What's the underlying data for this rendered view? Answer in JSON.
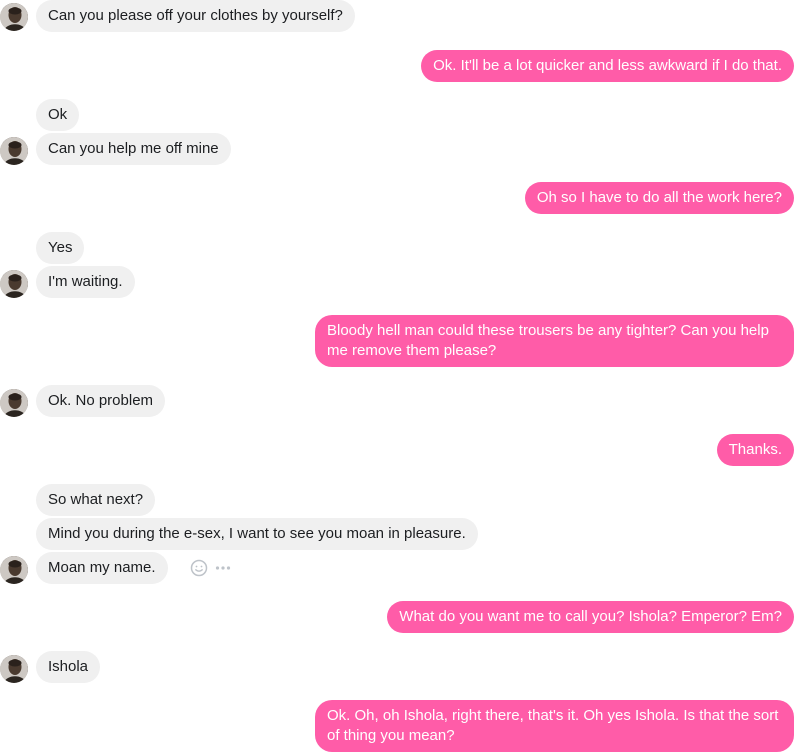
{
  "messages": [
    {
      "side": "in",
      "text": "Can you please off your clothes by yourself?"
    },
    {
      "side": "out",
      "text": "Ok. It'll be a lot quicker and less awkward if I do that."
    },
    {
      "side": "in",
      "text": "Ok"
    },
    {
      "side": "in",
      "text": "Can you help me off mine"
    },
    {
      "side": "out",
      "text": "Oh so I have to do all the work here?"
    },
    {
      "side": "in",
      "text": "Yes"
    },
    {
      "side": "in",
      "text": "I'm waiting."
    },
    {
      "side": "out",
      "text": "Bloody hell man could these trousers be any tighter? Can you help me remove them please?"
    },
    {
      "side": "in",
      "text": "Ok. No problem"
    },
    {
      "side": "out",
      "text": "Thanks."
    },
    {
      "side": "in",
      "text": "So what next?"
    },
    {
      "side": "in",
      "text": "Mind you during the e-sex, I want to see you moan in pleasure."
    },
    {
      "side": "in",
      "text": "Moan my name."
    },
    {
      "side": "out",
      "text": "What do you want me to call you? Ishola? Emperor? Em?"
    },
    {
      "side": "in",
      "text": "Ishola"
    },
    {
      "side": "out",
      "text": "Ok. Oh, oh Ishola, right there, that's it. Oh yes Ishola. Is that the sort of thing you mean?"
    }
  ],
  "hover_actions": {
    "react_icon": "smiley-icon",
    "more_icon": "more-horizontal-icon"
  },
  "colors": {
    "incoming_bg": "#f0f0f0",
    "incoming_text": "#1c1e21",
    "outgoing_bg": "#ff5ca8",
    "outgoing_text": "#ffffff"
  }
}
